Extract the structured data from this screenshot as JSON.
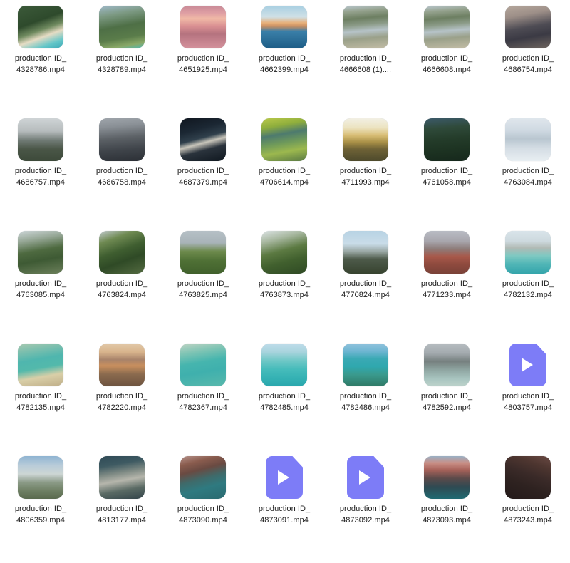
{
  "view": {
    "name": "file-explorer-icon-grid",
    "columns": 7,
    "rows": 5,
    "background_color": "#ffffff",
    "label_color": "#1b1b1b",
    "generic_icon_color": "#7d7cf7",
    "generic_icon_glyph_color": "#ffffff"
  },
  "files": [
    {
      "name_line1": "production ID_",
      "name_line2": "4328786.mp4",
      "icon": "video-thumbnail",
      "scene": "aerial beach cliff turquoise water"
    },
    {
      "name_line1": "production ID_",
      "name_line2": "4328789.mp4",
      "icon": "video-thumbnail",
      "scene": "aerial green valley coastline"
    },
    {
      "name_line1": "production ID_",
      "name_line2": "4651925.mp4",
      "icon": "video-thumbnail",
      "scene": "pink sunset over ocean"
    },
    {
      "name_line1": "production ID_",
      "name_line2": "4662399.mp4",
      "icon": "video-thumbnail",
      "scene": "blue sunset horizon calm sea"
    },
    {
      "name_line1": "production ID_",
      "name_line2": "4666608 (1)....",
      "icon": "video-thumbnail",
      "scene": "aerial river estuary"
    },
    {
      "name_line1": "production ID_",
      "name_line2": "4666608.mp4",
      "icon": "video-thumbnail",
      "scene": "aerial river estuary"
    },
    {
      "name_line1": "production ID_",
      "name_line2": "4686754.mp4",
      "icon": "video-thumbnail",
      "scene": "city skyscrapers dusk"
    },
    {
      "name_line1": "production ID_",
      "name_line2": "4686757.mp4",
      "icon": "video-thumbnail",
      "scene": "city skyline hazy horizon"
    },
    {
      "name_line1": "production ID_",
      "name_line2": "4686758.mp4",
      "icon": "video-thumbnail",
      "scene": "dense city towers aerial"
    },
    {
      "name_line1": "production ID_",
      "name_line2": "4687379.mp4",
      "icon": "video-thumbnail",
      "scene": "dark night city lights"
    },
    {
      "name_line1": "production ID_",
      "name_line2": "4706614.mp4",
      "icon": "video-thumbnail",
      "scene": "yellow green aerial wetlands"
    },
    {
      "name_line1": "production ID_",
      "name_line2": "4711993.mp4",
      "icon": "video-thumbnail",
      "scene": "golden sunrise over hills"
    },
    {
      "name_line1": "production ID_",
      "name_line2": "4761058.mp4",
      "icon": "video-thumbnail",
      "scene": "dark green forest aerial"
    },
    {
      "name_line1": "production ID_",
      "name_line2": "4763084.mp4",
      "icon": "video-thumbnail",
      "scene": "white clouds mist"
    },
    {
      "name_line1": "production ID_",
      "name_line2": "4763085.mp4",
      "icon": "video-thumbnail",
      "scene": "green ridge in cloud"
    },
    {
      "name_line1": "production ID_",
      "name_line2": "4763824.mp4",
      "icon": "video-thumbnail",
      "scene": "steep green mountain ridge"
    },
    {
      "name_line1": "production ID_",
      "name_line2": "4763825.mp4",
      "icon": "video-thumbnail",
      "scene": "green hillside grey sky"
    },
    {
      "name_line1": "production ID_",
      "name_line2": "4763873.mp4",
      "icon": "video-thumbnail",
      "scene": "green cliff with fog"
    },
    {
      "name_line1": "production ID_",
      "name_line2": "4770824.mp4",
      "icon": "video-thumbnail",
      "scene": "city under pale blue sky"
    },
    {
      "name_line1": "production ID_",
      "name_line2": "4771233.mp4",
      "icon": "video-thumbnail",
      "scene": "red rooftops city overcast"
    },
    {
      "name_line1": "production ID_",
      "name_line2": "4782132.mp4",
      "icon": "video-thumbnail",
      "scene": "beachfront hotels turquoise sea"
    },
    {
      "name_line1": "production ID_",
      "name_line2": "4782135.mp4",
      "icon": "video-thumbnail",
      "scene": "palm tree tropical beach"
    },
    {
      "name_line1": "production ID_",
      "name_line2": "4782220.mp4",
      "icon": "video-thumbnail",
      "scene": "orange sunset beach clouds"
    },
    {
      "name_line1": "production ID_",
      "name_line2": "4782367.mp4",
      "icon": "video-thumbnail",
      "scene": "palm trunk turquoise lagoon"
    },
    {
      "name_line1": "production ID_",
      "name_line2": "4782485.mp4",
      "icon": "video-thumbnail",
      "scene": "turquoise surf waves"
    },
    {
      "name_line1": "production ID_",
      "name_line2": "4782486.mp4",
      "icon": "video-thumbnail",
      "scene": "aerial reef turquoise lagoon"
    },
    {
      "name_line1": "production ID_",
      "name_line2": "4782592.mp4",
      "icon": "video-thumbnail",
      "scene": "grey city beach storm"
    },
    {
      "name_line1": "production ID_",
      "name_line2": "4803757.mp4",
      "icon": "generic-video-file",
      "scene": ""
    },
    {
      "name_line1": "production ID_",
      "name_line2": "4806359.mp4",
      "icon": "video-thumbnail",
      "scene": "clouds over distant town"
    },
    {
      "name_line1": "production ID_",
      "name_line2": "4813177.mp4",
      "icon": "video-thumbnail",
      "scene": "aerial marina boats docks"
    },
    {
      "name_line1": "production ID_",
      "name_line2": "4873090.mp4",
      "icon": "video-thumbnail",
      "scene": "coastal cliffs teal bay"
    },
    {
      "name_line1": "production ID_",
      "name_line2": "4873091.mp4",
      "icon": "generic-video-file",
      "scene": ""
    },
    {
      "name_line1": "production ID_",
      "name_line2": "4873092.mp4",
      "icon": "generic-video-file",
      "scene": ""
    },
    {
      "name_line1": "production ID_",
      "name_line2": "4873093.mp4",
      "icon": "video-thumbnail",
      "scene": "pink dusk coastline town"
    },
    {
      "name_line1": "production ID_",
      "name_line2": "4873243.mp4",
      "icon": "video-thumbnail",
      "scene": "dark mountain silhouette dusk"
    }
  ]
}
